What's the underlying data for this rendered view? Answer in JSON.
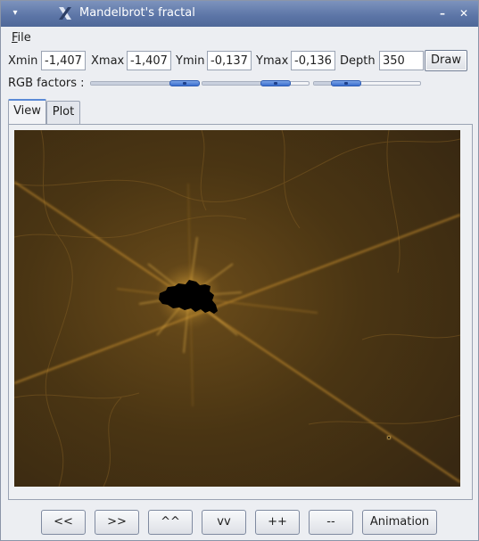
{
  "window": {
    "title": "Mandelbrot's fractal",
    "menu_glyph": "▾",
    "minimize_glyph": "–",
    "close_glyph": "✕"
  },
  "menubar": {
    "file_accel": "F",
    "file_rest": "ile"
  },
  "params": {
    "xmin_label": "Xmin",
    "xmin_value": "-1,40794",
    "xmax_label": "Xmax",
    "xmax_value": "-1,40794",
    "ymin_label": "Ymin",
    "ymin_value": "-0,13700",
    "ymax_label": "Ymax",
    "ymax_value": "-0,13699",
    "depth_label": "Depth",
    "depth_value": "350",
    "draw_label": "Draw"
  },
  "rgb": {
    "label": "RGB factors :",
    "sliders": [
      {
        "name": "red",
        "fraction": 0.88
      },
      {
        "name": "green",
        "fraction": 0.69
      },
      {
        "name": "blue",
        "fraction": 0.3
      }
    ]
  },
  "tabs": [
    {
      "label": "View",
      "active": true
    },
    {
      "label": "Plot",
      "active": false
    }
  ],
  "colors": {
    "fractal_bg": "#3e2d12",
    "fractal_glow": "#f2c24a",
    "set": "#000000",
    "slider_accent": "#3b6fcf"
  },
  "bottom_buttons": {
    "left": "<<",
    "right": ">>",
    "up": "^^",
    "down": "vv",
    "zoom_in": "++",
    "zoom_out": "--",
    "animation": "Animation"
  }
}
